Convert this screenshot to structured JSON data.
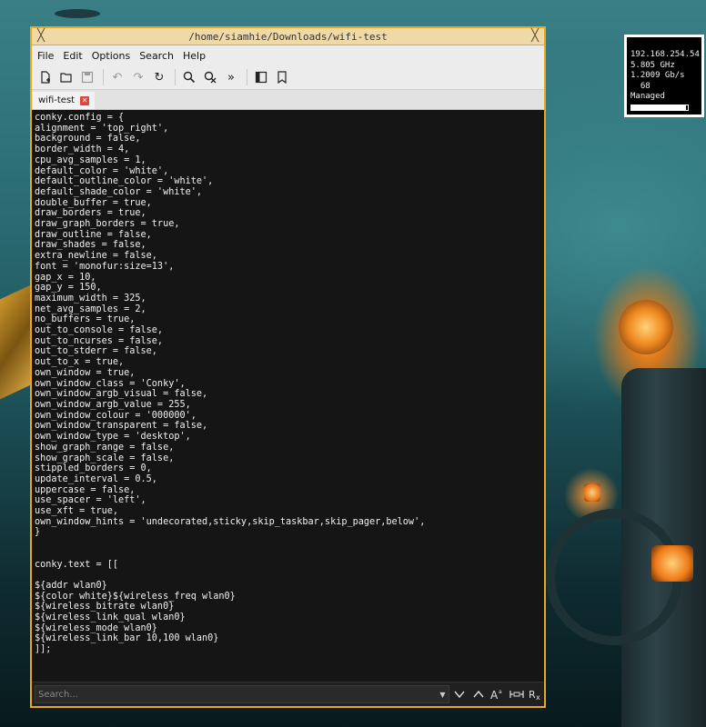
{
  "window": {
    "title": "/home/siamhie/Downloads/wifi-test",
    "close_glyph": "╳"
  },
  "menubar": {
    "items": [
      "File",
      "Edit",
      "Options",
      "Search",
      "Help"
    ]
  },
  "toolbar": {
    "icons": [
      "new-file-icon",
      "open-folder-icon",
      "save-icon",
      "undo-icon",
      "redo-icon",
      "reload-icon",
      "find-icon",
      "replace-icon",
      "jump-icon",
      "sidebar-icon",
      "bookmark-icon"
    ]
  },
  "tabs": [
    {
      "label": "wifi-test",
      "close": "✕"
    }
  ],
  "editor": {
    "lines": [
      "conky.config = {",
      "alignment = 'top_right',",
      "background = false,",
      "border_width = 4,",
      "cpu_avg_samples = 1,",
      "default_color = 'white',",
      "default_outline_color = 'white',",
      "default_shade_color = 'white',",
      "double_buffer = true,",
      "draw_borders = true,",
      "draw_graph_borders = true,",
      "draw_outline = false,",
      "draw_shades = false,",
      "extra_newline = false,",
      "font = 'monofur:size=13',",
      "gap_x = 10,",
      "gap_y = 150,",
      "maximum_width = 325,",
      "net_avg_samples = 2,",
      "no_buffers = true,",
      "out_to_console = false,",
      "out_to_ncurses = false,",
      "out_to_stderr = false,",
      "out_to_x = true,",
      "own_window = true,",
      "own_window_class = 'Conky',",
      "own_window_argb_visual = false,",
      "own_window_argb_value = 255,",
      "own_window_colour = '000000',",
      "own_window_transparent = false,",
      "own_window_type = 'desktop',",
      "show_graph_range = false,",
      "show_graph_scale = false,",
      "stippled_borders = 0,",
      "update_interval = 0.5,",
      "uppercase = false,",
      "use_spacer = 'left',",
      "use_xft = true,",
      "own_window_hints = 'undecorated,sticky,skip_taskbar,skip_pager,below',",
      "}",
      "",
      "",
      "conky.text = [[",
      "",
      "${addr wlan0}",
      "${color white}${wireless_freq wlan0}",
      "${wireless_bitrate wlan0}",
      "${wireless_link_qual wlan0}",
      "${wireless_mode wlan0}",
      "${wireless_link_bar 10,100 wlan0}",
      "]];"
    ]
  },
  "search": {
    "placeholder": "Search...",
    "value": "",
    "dropdown_glyph": "▼"
  },
  "conky": {
    "ip": "192.168.254.54",
    "freq": "5.805 GHz",
    "bitrate": "1.2009 Gb/s",
    "link_qual": "  68",
    "mode": "Managed",
    "link_bar_fraction": 0.96
  },
  "colors": {
    "window_border": "#e8a622",
    "titlebar_bg": "#efd9a6",
    "editor_bg": "#151515"
  }
}
